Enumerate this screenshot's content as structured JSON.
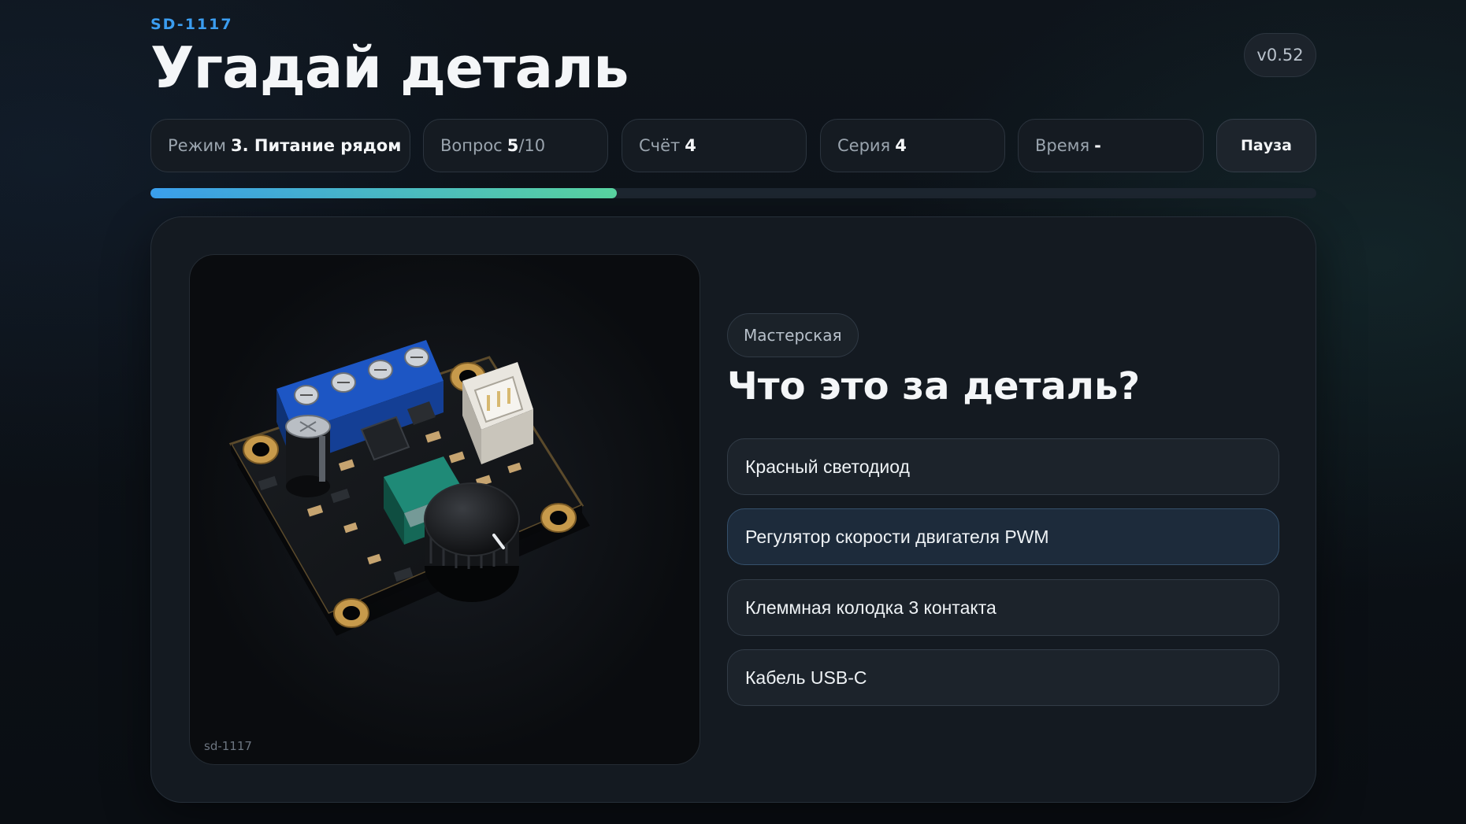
{
  "header": {
    "brand": "SD-1117",
    "title": "Угадай деталь",
    "version": "v0.52"
  },
  "stats": {
    "mode": {
      "label": "Режим",
      "value": "3. Питание рядом"
    },
    "question": {
      "label": "Вопрос",
      "current": "5",
      "total": "/10"
    },
    "score": {
      "label": "Счёт",
      "value": "4"
    },
    "streak": {
      "label": "Серия",
      "value": "4"
    },
    "time": {
      "label": "Время",
      "value": "-"
    },
    "pause_label": "Пауза"
  },
  "progress": {
    "fraction": 0.4
  },
  "colors": {
    "accent_blue": "#3ba0ee",
    "accent_green": "#5ad6a2",
    "background": "#0b1016",
    "card": "#141a21"
  },
  "quiz": {
    "photo_caption": "sd-1117",
    "photo_icon": "pwm-motor-speed-controller-board",
    "category": "Мастерская",
    "question": "Что это за деталь?",
    "options": [
      "Красный светодиод",
      "Регулятор скорости двигателя PWM",
      "Клеммная колодка 3 контакта",
      "Кабель USB-C"
    ],
    "hovered_option": 1
  }
}
